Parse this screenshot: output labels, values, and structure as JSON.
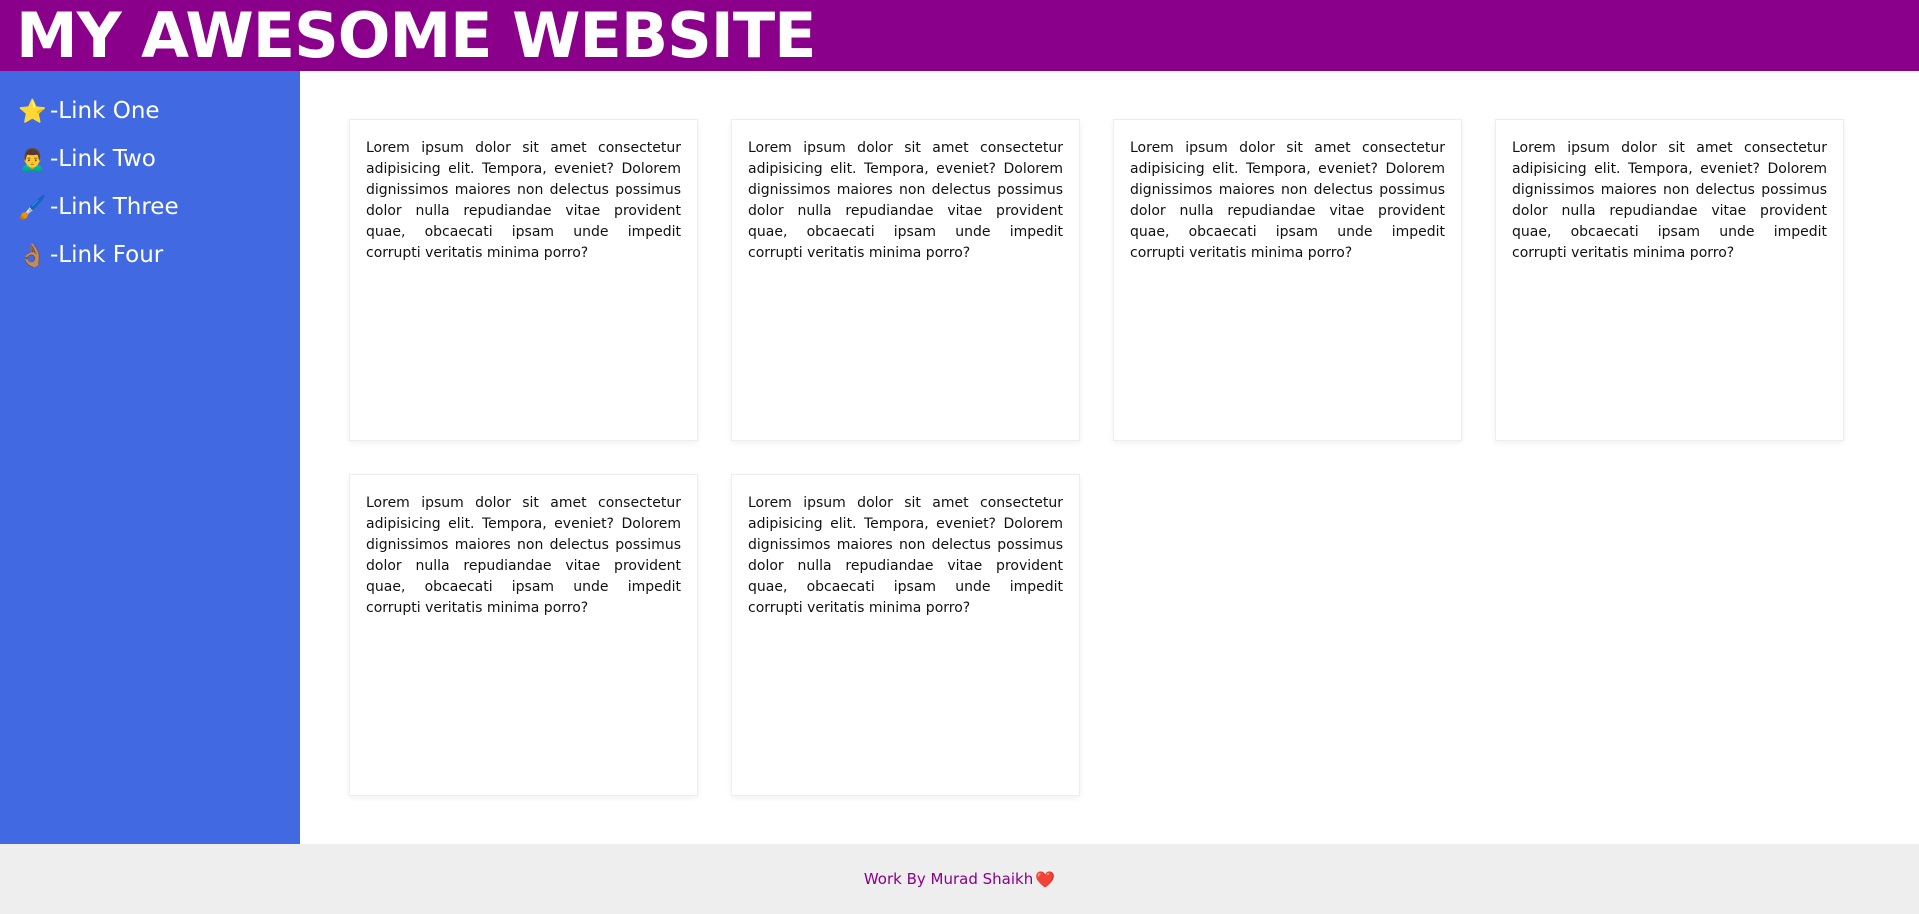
{
  "header": {
    "title": "MY AWESOME WEBSITE"
  },
  "sidebar": {
    "items": [
      {
        "icon": "⭐",
        "icon_name": "star-icon",
        "label": "-Link One"
      },
      {
        "icon": "🙍‍♂️",
        "icon_name": "person-icon",
        "label": "-Link Two"
      },
      {
        "icon": "🖌️",
        "icon_name": "paintbrush-icon",
        "label": "-Link Three"
      },
      {
        "icon": "👌🏽",
        "icon_name": "ok-hand-icon",
        "label": "-Link Four"
      }
    ]
  },
  "main": {
    "cards": [
      {
        "text": "Lorem ipsum dolor sit amet consectetur adipisicing elit. Tempora, eveniet? Dolorem dignissimos maiores non delectus possimus dolor nulla repudiandae vitae provident quae, obcaecati ipsam unde impedit corrupti veritatis minima porro?"
      },
      {
        "text": "Lorem ipsum dolor sit amet consectetur adipisicing elit. Tempora, eveniet? Dolorem dignissimos maiores non delectus possimus dolor nulla repudiandae vitae provident quae, obcaecati ipsam unde impedit corrupti veritatis minima porro?"
      },
      {
        "text": "Lorem ipsum dolor sit amet consectetur adipisicing elit. Tempora, eveniet? Dolorem dignissimos maiores non delectus possimus dolor nulla repudiandae vitae provident quae, obcaecati ipsam unde impedit corrupti veritatis minima porro?"
      },
      {
        "text": "Lorem ipsum dolor sit amet consectetur adipisicing elit. Tempora, eveniet? Dolorem dignissimos maiores non delectus possimus dolor nulla repudiandae vitae provident quae, obcaecati ipsam unde impedit corrupti veritatis minima porro?"
      },
      {
        "text": "Lorem ipsum dolor sit amet consectetur adipisicing elit. Tempora, eveniet? Dolorem dignissimos maiores non delectus possimus dolor nulla repudiandae vitae provident quae, obcaecati ipsam unde impedit corrupti veritatis minima porro?"
      },
      {
        "text": "Lorem ipsum dolor sit amet consectetur adipisicing elit. Tempora, eveniet? Dolorem dignissimos maiores non delectus possimus dolor nulla repudiandae vitae provident quae, obcaecati ipsam unde impedit corrupti veritatis minima porro?"
      }
    ]
  },
  "footer": {
    "text": "Work By Murad Shaikh",
    "heart": "❤️"
  },
  "colors": {
    "header_bg": "#8b008b",
    "sidebar_bg": "#4169e1",
    "footer_bg": "#eeeeee",
    "footer_text": "#8b008b"
  }
}
